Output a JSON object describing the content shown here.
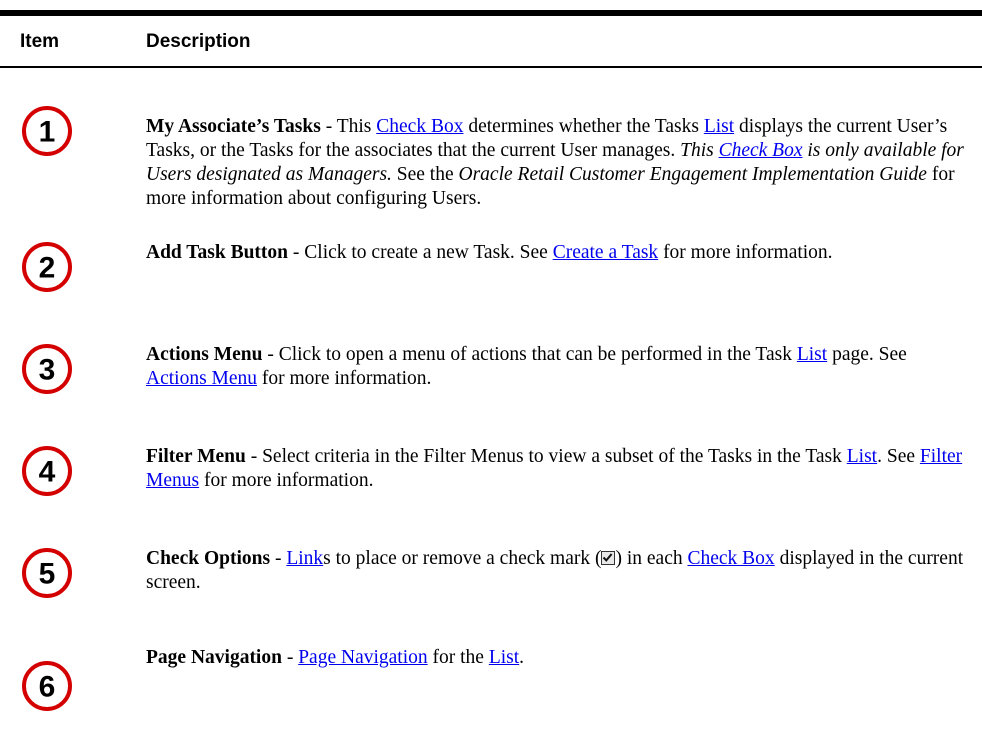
{
  "table": {
    "header": {
      "item": "Item",
      "description": "Description"
    },
    "rows": [
      {
        "number": "1",
        "title": "My Associate’s Tasks",
        "dash": " - ",
        "parts": {
          "a": "This ",
          "link1": "Check Box",
          "b": " determines whether the Tasks ",
          "link2": "List",
          "c": " displays the current User’s Tasks, or the Tasks for the associates that the current User manages. ",
          "italic1": "This ",
          "link3": "Check Box",
          "italic2": " is only available for Users designated as Managers.",
          "d": " See the ",
          "italic3": "Oracle Retail Customer Engagement Implementation Guide",
          "e": " for more information about configuring Users."
        }
      },
      {
        "number": "2",
        "title": "Add Task Button",
        "dash": " - ",
        "parts": {
          "a": "Click to create a new Task. See ",
          "link1": "Create a Task",
          "b": " for more information."
        }
      },
      {
        "number": "3",
        "title": "Actions Menu",
        "dash": " - ",
        "parts": {
          "a": "Click to open a menu of actions that can be performed in the Task ",
          "link1": "List",
          "b": " page. See ",
          "link2": "Actions Menu",
          "c": " for more information."
        }
      },
      {
        "number": "4",
        "title": "Filter Menu",
        "dash": " - ",
        "parts": {
          "a": "Select criteria in the Filter Menus to view a subset of the Tasks in the Task ",
          "link1": "List",
          "b": ". See ",
          "link2": "Filter Menus",
          "c": " for more information."
        }
      },
      {
        "number": "5",
        "title": "Check Options",
        "dash": " - ",
        "parts": {
          "link1": "Link",
          "a": "s to place or remove a check mark (",
          "b": ") in each ",
          "link2": "Check Box",
          "c": " displayed in the current screen."
        }
      },
      {
        "number": "6",
        "title": "Page Navigation",
        "dash": " - ",
        "parts": {
          "link1": "Page Navigation",
          "a": " for the ",
          "link2": "List",
          "b": "."
        }
      }
    ]
  },
  "colors": {
    "callout_ring": "#d40000",
    "link": "#0000ee"
  },
  "icons": {
    "callout": "numbered-circle-callout-icon",
    "checkmark": "checkbox-checked-icon"
  }
}
